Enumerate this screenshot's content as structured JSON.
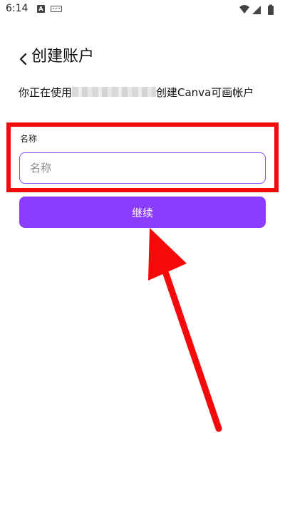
{
  "status_bar": {
    "time": "6:14",
    "icons": [
      "a-notification-icon",
      "keyboard-icon",
      "wifi-icon",
      "signal-icon",
      "battery-icon"
    ]
  },
  "header": {
    "back_icon": "chevron-left-icon",
    "title": "创建账户"
  },
  "description": {
    "prefix": "你正在使用",
    "suffix": "创建Canva可画帐户"
  },
  "form": {
    "name_label": "名称",
    "name_value": "",
    "name_placeholder": "名称",
    "accent_color": "#8b3dff"
  },
  "actions": {
    "continue_label": "继续"
  },
  "annotation": {
    "highlight_color": "#f40a0a"
  }
}
